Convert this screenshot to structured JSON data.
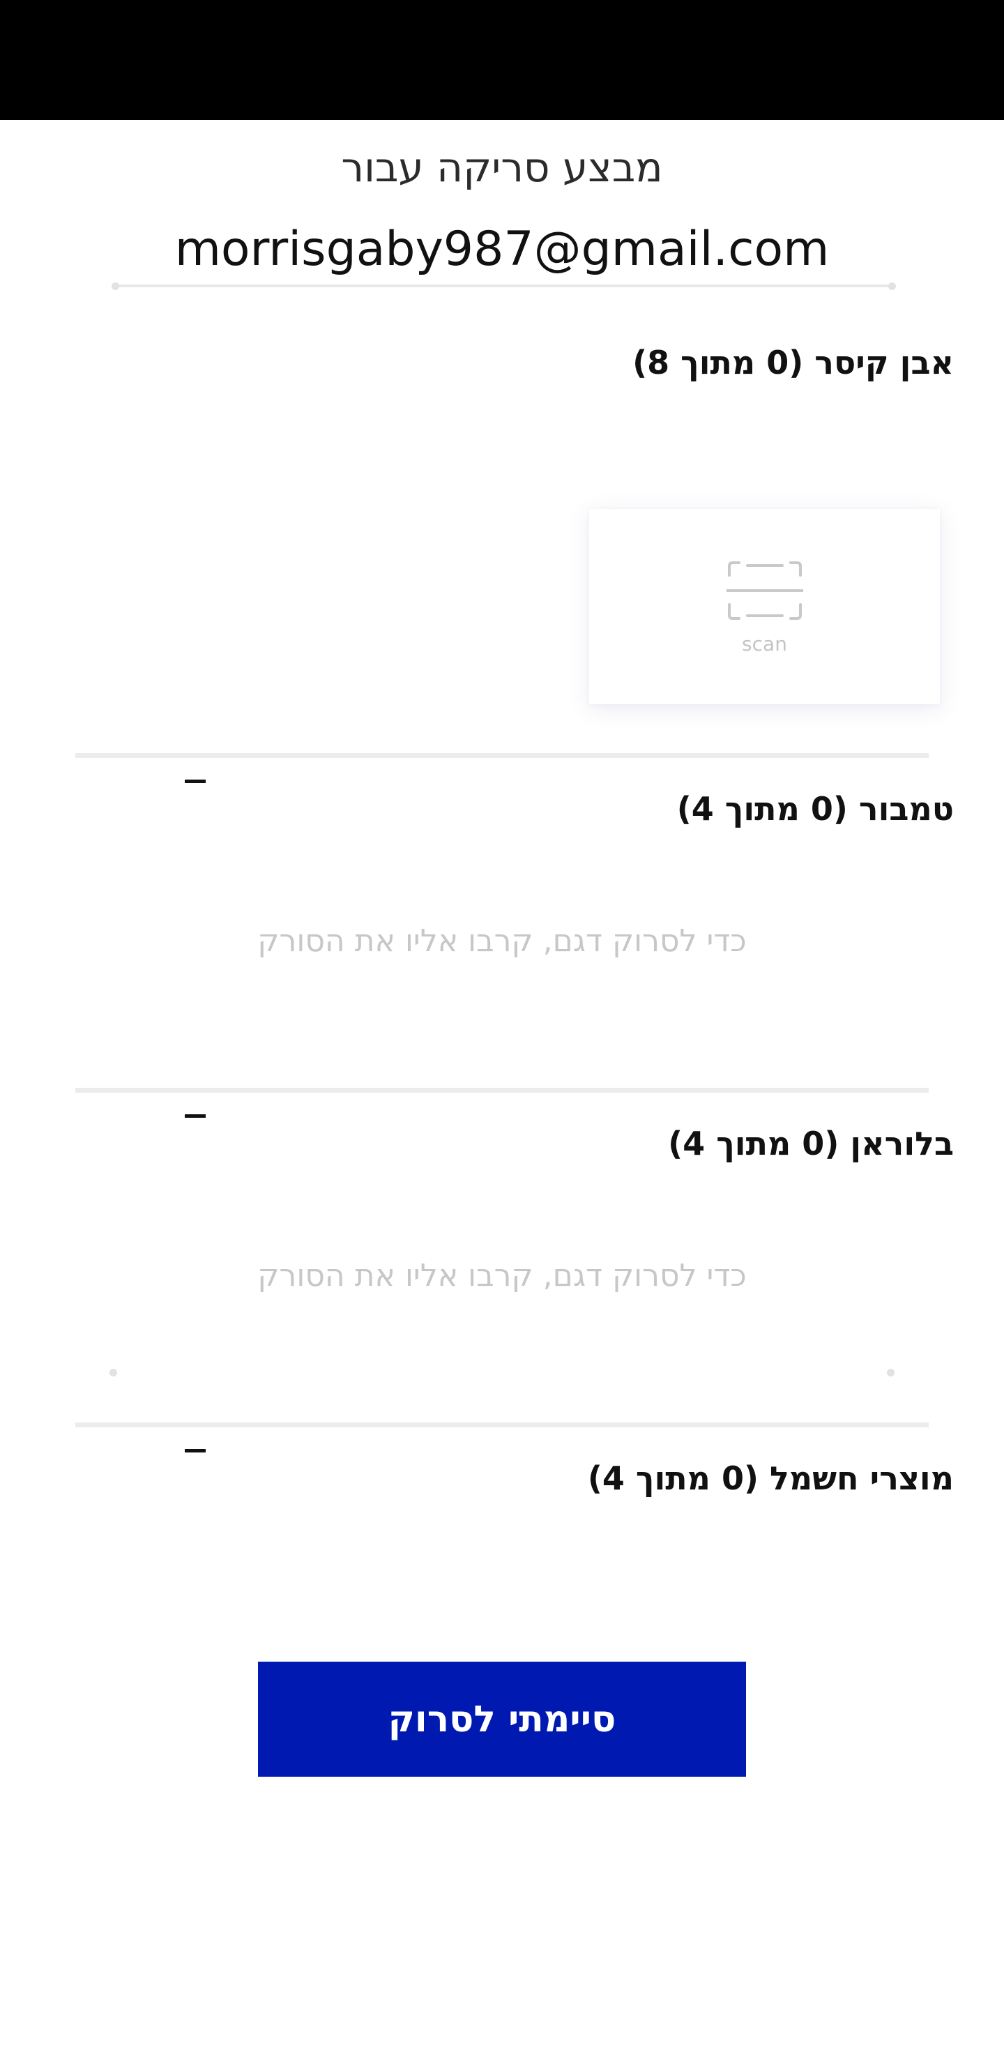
{
  "header": {
    "heading": "מבצע סריקה עבור",
    "email": "morrisgaby987@gmail.com"
  },
  "sections": [
    {
      "title": "אבן קיסר (0 מתוך 8)",
      "scan_label": "scan",
      "scan_icon": "scan-frame-icon"
    },
    {
      "title": "טמבור (0 מתוך 4)",
      "hint": "כדי לסרוק דגם, קרבו אליו את הסורק"
    },
    {
      "title": "בלוראן (0 מתוך 4)",
      "hint": "כדי לסרוק דגם, קרבו אליו את הסורק"
    },
    {
      "title": "מוצרי חשמל (0 מתוך 4)"
    }
  ],
  "done_button_label": "סיימתי לסרוק",
  "colors": {
    "primary_button": "#0019b0",
    "hint_text": "#c7c7c7",
    "divider": "#ececec"
  }
}
